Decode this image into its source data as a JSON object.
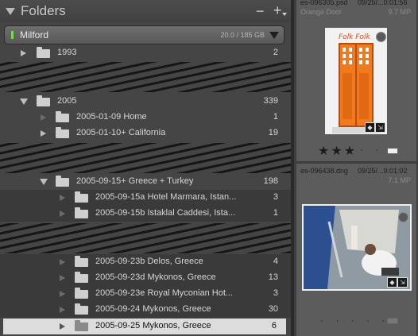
{
  "panel": {
    "title": "Folders",
    "remove_label": "−",
    "add_label": "+"
  },
  "volume": {
    "name": "Milford",
    "usage": "20.0 / 185 GB",
    "status_color": "#6ee04a"
  },
  "folders": {
    "f1993": {
      "name": "1993",
      "count": "2"
    },
    "f2005": {
      "name": "2005",
      "count": "339"
    },
    "home": {
      "name": "2005-01-09 Home",
      "count": "1"
    },
    "calif": {
      "name": "2005-01-10+ California",
      "count": "19"
    },
    "greece": {
      "name": "2005-09-15+ Greece + Turkey",
      "count": "198"
    },
    "g15a": {
      "name": "2005-09-15a Hotel Marmara, Istan...",
      "count": "3"
    },
    "g15b": {
      "name": "2005-09-15b Istaklal Caddesi, Ista...",
      "count": "1"
    },
    "g23b": {
      "name": "2005-09-23b Delos, Greece",
      "count": "4"
    },
    "g23d": {
      "name": "2005-09-23d Mykonos, Greece",
      "count": "13"
    },
    "g23e": {
      "name": "2005-09-23e Royal Myconian Hot...",
      "count": "3"
    },
    "g24": {
      "name": "2005-09-24 Mykonos, Greece",
      "count": "30"
    },
    "g25": {
      "name": "2005-09-25 Mykonos, Greece",
      "count": "6"
    }
  },
  "filmstrip": {
    "top": {
      "filename": "es-096305.psd",
      "datetime": "09/25/...0:01:56",
      "title": "Orange Door",
      "size": "9.7 MP",
      "rating": "★★★",
      "unrated": "· ·"
    },
    "bottom": {
      "filename": "es-096438.dng",
      "datetime": "09/25/...9:01:02",
      "size": "7.1 MP",
      "unrated": "· · · · ·"
    },
    "door_sign": "Folk Folk"
  }
}
